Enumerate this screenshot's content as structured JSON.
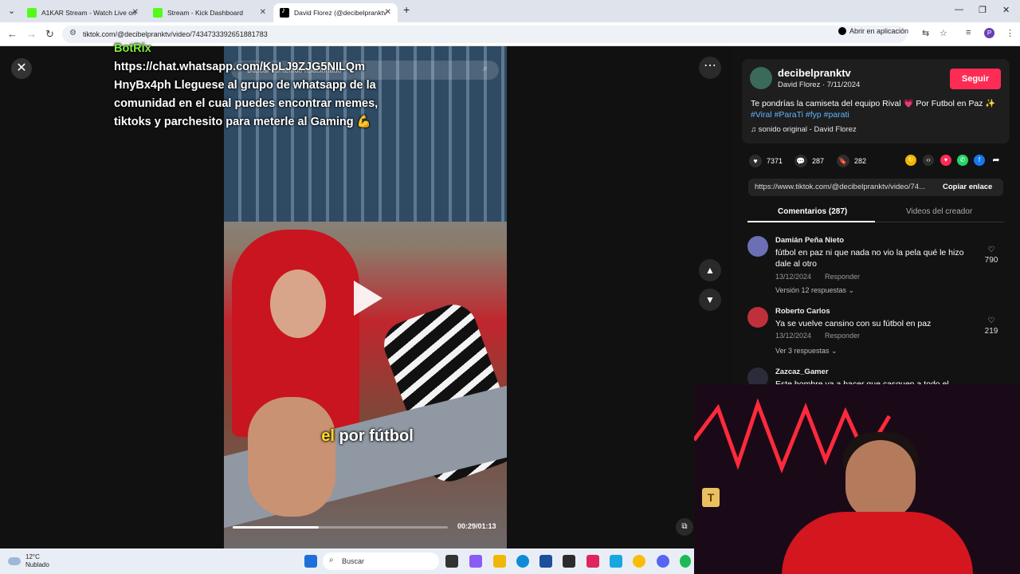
{
  "browser": {
    "tabs": [
      {
        "title": "A1KAR Stream - Watch Live on",
        "icon": "kick-icon",
        "active": false
      },
      {
        "title": "Stream - Kick Dashboard",
        "icon": "kick-icon",
        "active": false
      },
      {
        "title": "David Florez (@decibelpranktv",
        "icon": "tiktok-icon",
        "active": true
      }
    ],
    "new_tab": "+",
    "url": "tiktok.com/@decibelpranktv/video/7434733392651881783",
    "open_in_app": "Abrir en aplicación",
    "profile_initial": "P"
  },
  "video": {
    "search_placeholder": "Buscar contenido relacionado",
    "overlay": {
      "botrix": "BotRix",
      "message": "https://chat.whatsapp.com/KpLJ9ZJG5NILQm HnyBx4ph Lleguese al grupo de whatsapp de la comunidad en el cual puedes encontrar memes, tiktoks y parchesito para meterle al Gaming 💪"
    },
    "subtitle_highlight": "el",
    "subtitle_rest": "por fútbol",
    "progress": 0.4,
    "time": "00:29/01:13"
  },
  "post": {
    "username": "decibelpranktv",
    "meta": "David Florez · 7/11/2024",
    "follow_label": "Seguir",
    "caption_text": "Te pondrías la camiseta del equipo Rival 💗 Por Futbol en Paz ✨",
    "caption_tags": "#Viral #ParaTi #fyp #parati",
    "sound": "sonido original - David Florez",
    "likes": "7371",
    "comments": "287",
    "saves": "282",
    "link": "https://www.tiktok.com/@decibelpranktv/video/74...",
    "copy_link_label": "Copiar enlace",
    "tab_comments": "Comentarios (287)",
    "tab_creator": "Videos del creador"
  },
  "comments": [
    {
      "user": "Damián Peña Nieto",
      "text": "fútbol en paz ni que nada no vio la pela qué le hizo dale al otro",
      "date": "13/12/2024",
      "reply": "Responder",
      "more": "Versión 12 respuestas ⌄",
      "likes": "790",
      "avatar_color": "#6b6fb3"
    },
    {
      "user": "Roberto Carlos",
      "text": "Ya se vuelve cansino con su fútbol en paz",
      "date": "13/12/2024",
      "reply": "Responder",
      "more": "Ver 3 respuestas ⌄",
      "likes": "219",
      "avatar_color": "#c0303a"
    },
    {
      "user": "Zazcaz_Gamer",
      "text": "Este hombre va a hacer que casquen a todo el",
      "avatar_color": "#2b2b3a"
    }
  ],
  "taskbar": {
    "temp": "12°C",
    "weather": "Nublado",
    "search_placeholder": "Buscar"
  },
  "colors": {
    "accent": "#fe2c55",
    "tag": "#5fb4ff",
    "kick": "#53fc18"
  }
}
